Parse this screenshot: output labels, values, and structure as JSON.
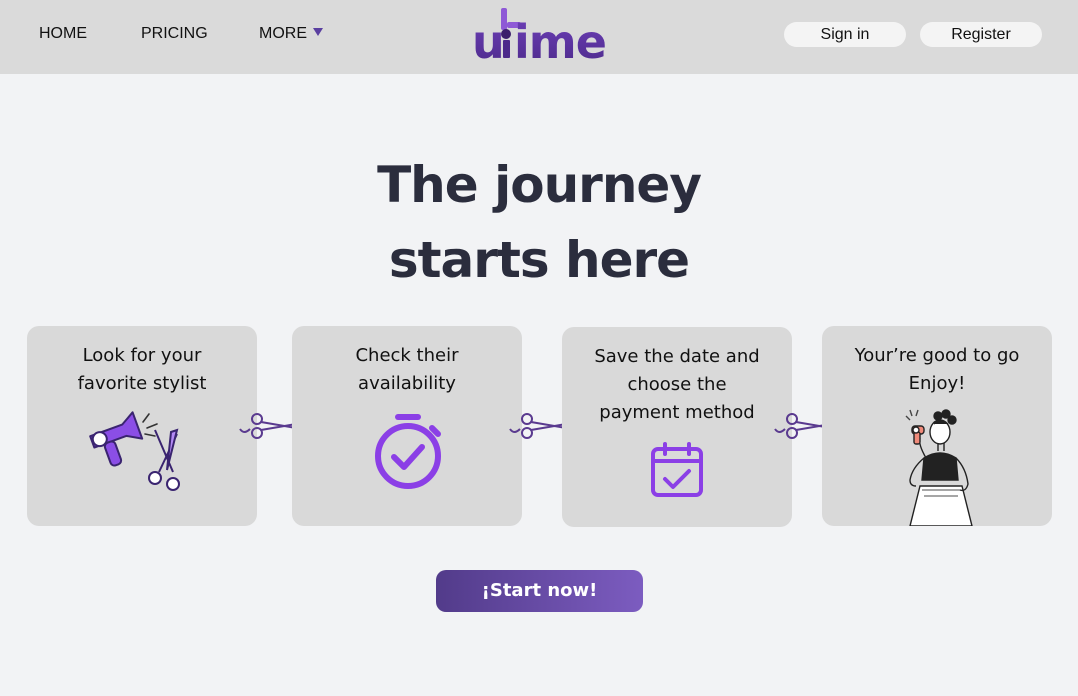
{
  "header": {
    "nav": {
      "home": "HOME",
      "pricing": "PRICING",
      "more": "MORE"
    },
    "logo_text": "utime",
    "sign_in": "Sign in",
    "register": "Register"
  },
  "hero": {
    "title_line1": "The journey",
    "title_line2": "starts here"
  },
  "steps": [
    {
      "line1": "Look for your",
      "line2": "favorite stylist",
      "icon": "hairdryer-scissors-icon"
    },
    {
      "line1": "Check their",
      "line2": "availability",
      "icon": "stopwatch-check-icon"
    },
    {
      "line1": "Save the date and",
      "line2": "choose the",
      "line3": "payment method",
      "icon": "calendar-check-icon"
    },
    {
      "line1": "Your’re good to go",
      "line2": "Enjoy!",
      "icon": "woman-hairdryer-illustration"
    }
  ],
  "cta": {
    "label": "¡Start now!"
  },
  "colors": {
    "accent": "#7c3aed",
    "purple_dark": "#523b8a",
    "header_bg": "#dadada",
    "card_bg": "#d9d9d9",
    "page_bg": "#f2f3f5"
  }
}
